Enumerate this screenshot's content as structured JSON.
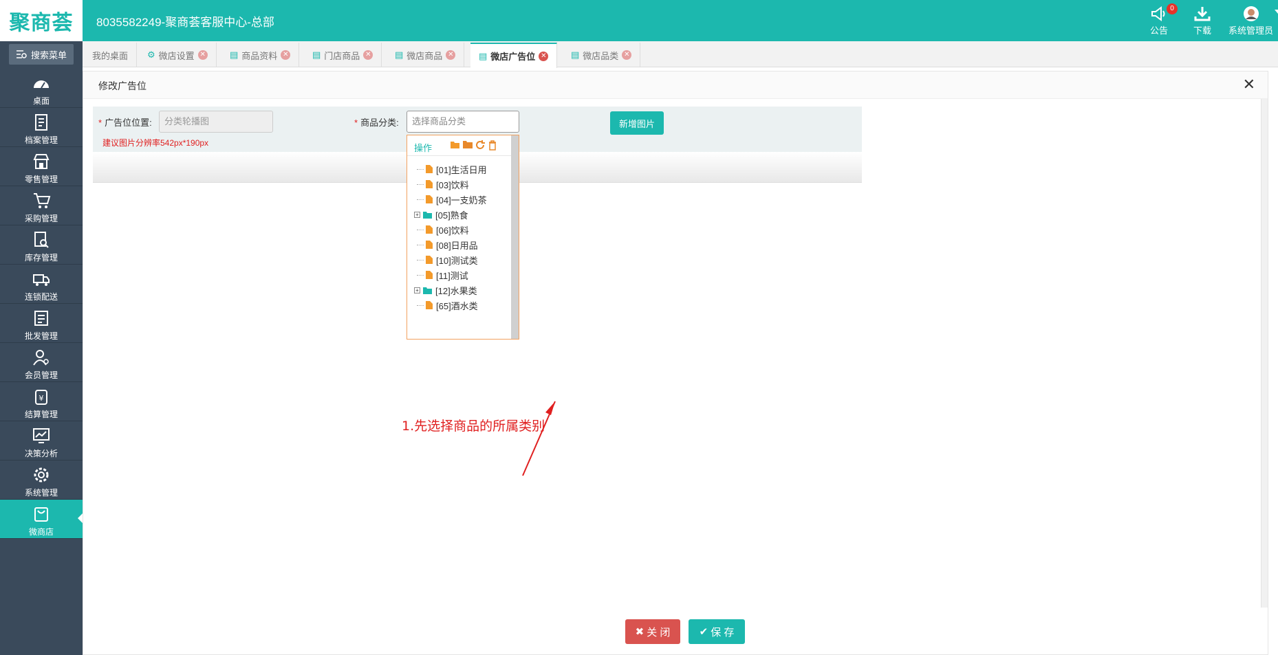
{
  "header": {
    "logo": "聚商荟",
    "title": "8035582249-聚商荟客服中心-总部",
    "notice_label": "公告",
    "notice_count": "0",
    "download_label": "下载",
    "user_label": "系统管理员"
  },
  "sidebar": {
    "search_label": "搜索菜单",
    "items": [
      {
        "label": "桌面",
        "icon": "dashboard-icon"
      },
      {
        "label": "档案管理",
        "icon": "archive-icon"
      },
      {
        "label": "零售管理",
        "icon": "store-icon"
      },
      {
        "label": "采购管理",
        "icon": "cart-icon"
      },
      {
        "label": "库存管理",
        "icon": "inventory-search-icon"
      },
      {
        "label": "连锁配送",
        "icon": "truck-icon"
      },
      {
        "label": "批发管理",
        "icon": "wholesale-icon"
      },
      {
        "label": "会员管理",
        "icon": "member-icon"
      },
      {
        "label": "结算管理",
        "icon": "settlement-icon"
      },
      {
        "label": "决策分析",
        "icon": "analysis-chart-icon"
      },
      {
        "label": "系统管理",
        "icon": "gear-icon"
      },
      {
        "label": "微商店",
        "icon": "shop-bag-icon",
        "active": true
      }
    ]
  },
  "tabs": [
    {
      "label": "我的桌面",
      "closable": false
    },
    {
      "label": "微店设置",
      "closable": true
    },
    {
      "label": "商品资料",
      "closable": true
    },
    {
      "label": "门店商品",
      "closable": true
    },
    {
      "label": "微店商品",
      "closable": true
    },
    {
      "label": "微店广告位",
      "closable": true,
      "active": true
    },
    {
      "label": "微店品类",
      "closable": true
    }
  ],
  "modal": {
    "title": "修改广告位",
    "form": {
      "position_label": "广告位位置:",
      "position_value": "分类轮播图",
      "category_label": "商品分类:",
      "category_placeholder": "选择商品分类",
      "hint": "建议图片分辨率542px*190px",
      "add_image_label": "新增图片"
    },
    "tree": {
      "ops_label": "操作",
      "nodes": [
        {
          "label": "[01]生活日用",
          "type": "leaf"
        },
        {
          "label": "[03]饮料",
          "type": "leaf"
        },
        {
          "label": "[04]一支奶茶",
          "type": "leaf"
        },
        {
          "label": "[05]熟食",
          "type": "folder"
        },
        {
          "label": "[06]饮料",
          "type": "leaf"
        },
        {
          "label": "[08]日用品",
          "type": "leaf"
        },
        {
          "label": "[10]测试类",
          "type": "leaf"
        },
        {
          "label": "[11]测试",
          "type": "leaf"
        },
        {
          "label": "[12]水果类",
          "type": "folder"
        },
        {
          "label": "[65]酒水类",
          "type": "leaf"
        }
      ]
    },
    "annotation": "1.先选择商品的所属类别",
    "close_label": "关 闭",
    "save_label": "保 存"
  },
  "colors": {
    "brand": "#1cb8ae",
    "sidebar": "#3a4a5b",
    "danger": "#d9534f",
    "annotation": "#e02020"
  }
}
